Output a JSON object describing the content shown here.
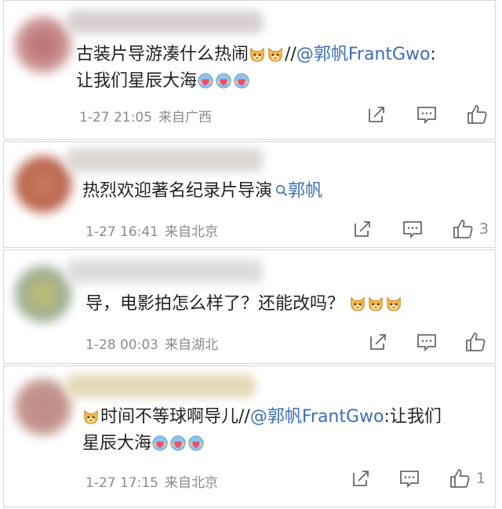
{
  "comments": [
    {
      "text_a": "古装片导游凑什么热闹",
      "text_b": "//",
      "mention": "@郭帆FrantGwo",
      "text_c": ":",
      "text_line2": "让我们星辰大海",
      "date": "1-27 21:05",
      "location": "来自广西",
      "likes": ""
    },
    {
      "text_a": "热烈欢迎著名纪录片导演",
      "mention": "郭帆",
      "date": "1-27 16:41",
      "location": "来自北京",
      "likes": "3"
    },
    {
      "text_a": "导，电影拍怎么样了？还能改吗？",
      "date": "1-28 00:03",
      "location": "来自湖北",
      "likes": ""
    },
    {
      "text_a": "时间不等球啊导儿",
      "text_b": "//",
      "mention": "@郭帆FrantGwo",
      "text_c": ":让我们",
      "text_line2": "星辰大海",
      "date": "1-27 17:15",
      "location": "来自北京",
      "likes": "1"
    }
  ],
  "icons": {
    "share": "share-icon",
    "comment": "comment-icon",
    "like": "thumbs-up-icon",
    "emoji_cat": "cat-face-emoji",
    "emoji_heart": "heart-hug-emoji",
    "search": "search-icon"
  },
  "colors": {
    "mention": "#3b6fb5",
    "meta": "#8b8b8b",
    "border": "#d6d6d6"
  }
}
